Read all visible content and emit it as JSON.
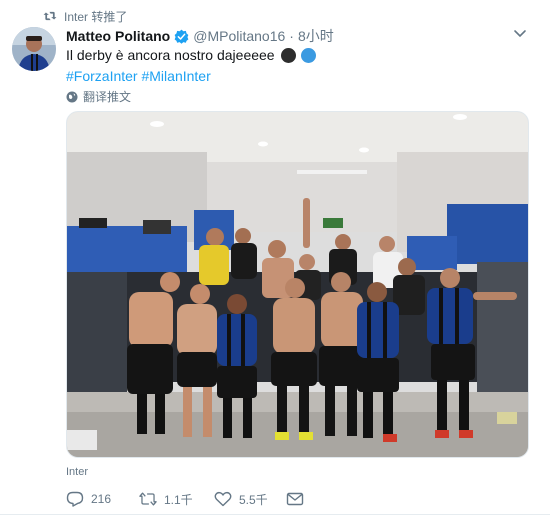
{
  "retweet": {
    "label": "Inter 转推了"
  },
  "author": {
    "name": "Matteo Politano",
    "handle": "@MPolitano16",
    "separator": "·",
    "time": "8小时"
  },
  "tweet": {
    "text": "Il derby è ancora nostro dajeeeee",
    "hashtags": [
      "#ForzaInter",
      "#MilanInter"
    ]
  },
  "translate": {
    "label": "翻译推文"
  },
  "source": {
    "label": "Inter"
  },
  "actions": {
    "reply_count": "216",
    "retweet_count": "1.1千",
    "like_count": "5.5千"
  },
  "icons": {
    "retweet": "retweet-icon",
    "verified": "verified-badge-icon",
    "caret": "chevron-down-icon",
    "globe": "globe-icon",
    "reply": "reply-icon",
    "like": "heart-icon",
    "message": "envelope-icon"
  },
  "colors": {
    "link": "#1da1f2",
    "muted": "#657786",
    "text": "#14171a",
    "verified": "#1da1f2"
  }
}
